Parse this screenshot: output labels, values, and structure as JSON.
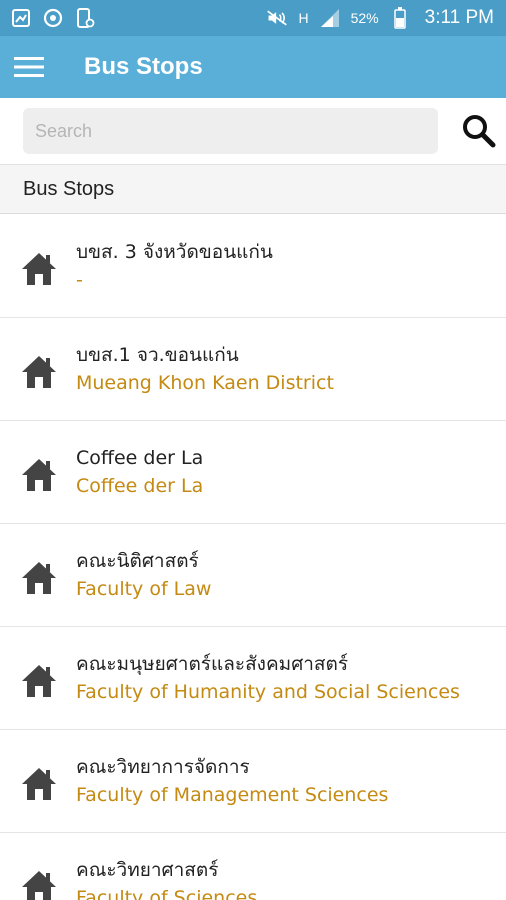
{
  "status_bar": {
    "battery": "52%",
    "time": "3:11 PM",
    "network": "H",
    "icons": [
      "gallery-icon",
      "sync-icon",
      "phone-settings-icon",
      "mute-icon",
      "signal-icon",
      "battery-icon"
    ]
  },
  "app_bar": {
    "title": "Bus Stops",
    "menu_icon": "hamburger-menu-icon"
  },
  "search": {
    "placeholder": "Search",
    "value": "",
    "icon": "search-icon"
  },
  "section": {
    "title": "Bus Stops"
  },
  "stops": [
    {
      "name": "บขส. 3 จังหวัดขอนแก่น",
      "subtitle": "-"
    },
    {
      "name": "บขส.1 จว.ขอนแก่น",
      "subtitle": "Mueang Khon Kaen District"
    },
    {
      "name": "Coffee der La",
      "subtitle": "Coffee der La"
    },
    {
      "name": "คณะนิติศาสตร์",
      "subtitle": "Faculty of Law"
    },
    {
      "name": "คณะมนุษยศาตร์และสังคมศาสตร์",
      "subtitle": "Faculty of Humanity and Social Sciences"
    },
    {
      "name": "คณะวิทยาการจัดการ",
      "subtitle": "Faculty of Management Sciences"
    },
    {
      "name": "คณะวิทยาศาสตร์",
      "subtitle": "Faculty of Sciences"
    }
  ],
  "colors": {
    "status_bar": "#4a9dc6",
    "app_bar": "#5aafd8",
    "subtitle": "#c48a12",
    "icon": "#444444"
  }
}
